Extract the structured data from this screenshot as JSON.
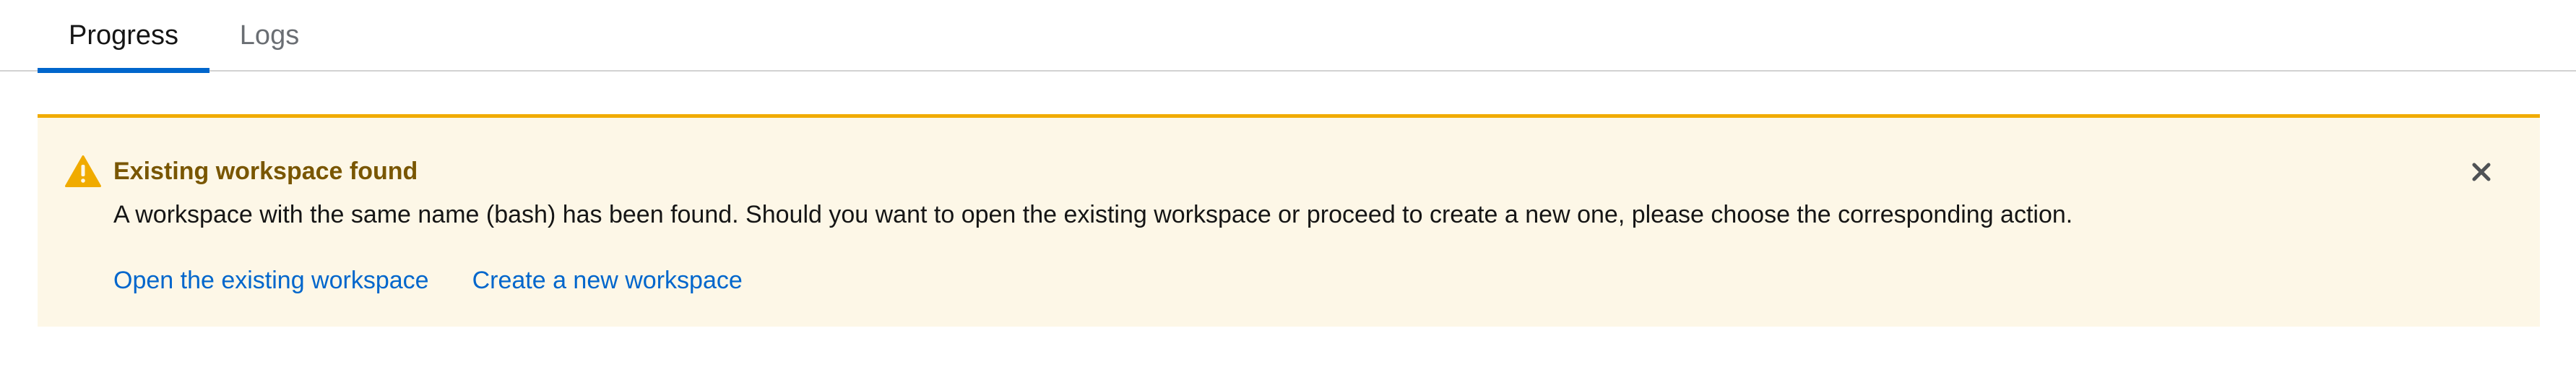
{
  "tabs": [
    {
      "label": "Progress",
      "active": true
    },
    {
      "label": "Logs",
      "active": false
    }
  ],
  "alert": {
    "variant": "warning",
    "icon": "exclamation-triangle-icon",
    "title": "Existing workspace found",
    "message": "A workspace with the same name (bash) has been found. Should you want to open the existing workspace or proceed to create a new one, please choose the corresponding action.",
    "actions": [
      {
        "label": "Open the existing workspace"
      },
      {
        "label": "Create a new workspace"
      }
    ],
    "close_icon": "close-icon"
  },
  "colors": {
    "tab_active_underline": "#0066cc",
    "alert_background": "#fdf7e7",
    "alert_border": "#f0ab00",
    "alert_title": "#795600",
    "link": "#0066cc",
    "icon_warning": "#f0ab00",
    "close_icon": "#4f5255"
  }
}
